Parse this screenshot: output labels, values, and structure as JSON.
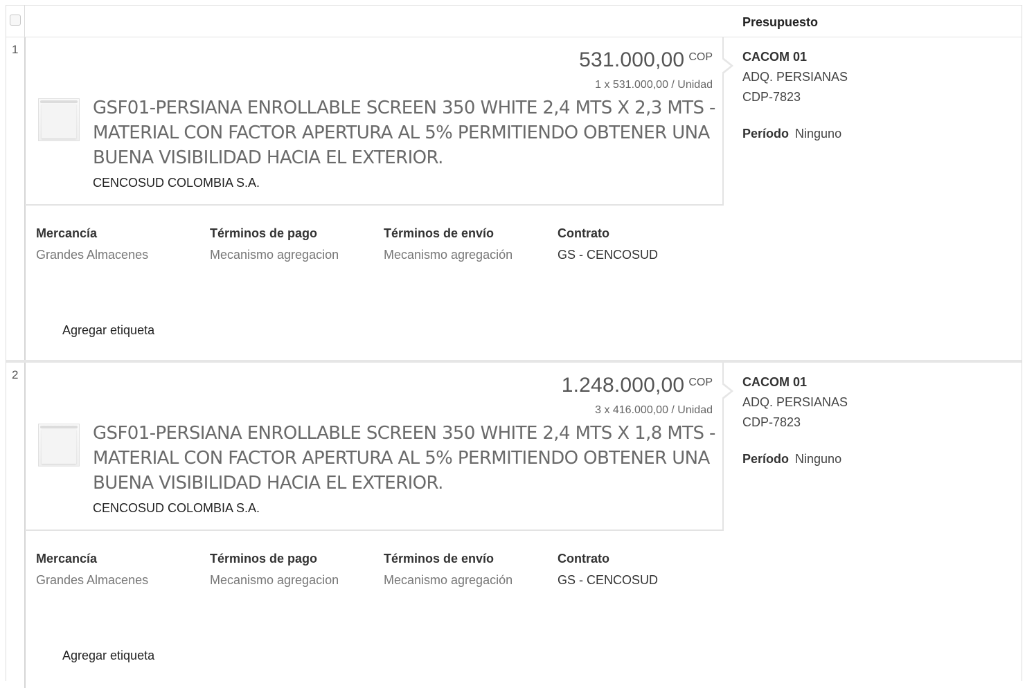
{
  "header": {
    "budget_title": "Presupuesto"
  },
  "items": [
    {
      "row_number": "1",
      "price_amount": "531.000,00",
      "currency": "COP",
      "unit_price": "1 x 531.000,00 / Unidad",
      "description": "GSF01-PERSIANA ENROLLABLE SCREEN 350 WHITE 2,4 MTS X 2,3 MTS - MATERIAL CON FACTOR APERTURA AL 5% PERMITIENDO OBTENER UNA BUENA VISIBILIDAD HACIA EL EXTERIOR.",
      "supplier": "CENCOSUD COLOMBIA S.A.",
      "details": [
        {
          "title": "Mercancía",
          "value": "Grandes Almacenes"
        },
        {
          "title": "Términos de pago",
          "value": "Mecanismo agregacion"
        },
        {
          "title": "Términos de envío",
          "value": "Mecanismo agregación"
        },
        {
          "title": "Contrato",
          "value": "GS - CENCOSUD"
        }
      ],
      "add_tag": "Agregar etiqueta",
      "budget": {
        "code": "CACOM 01",
        "line1": "ADQ. PERSIANAS",
        "line2": "CDP-7823",
        "period_label": "Período",
        "period_value": "Ninguno"
      }
    },
    {
      "row_number": "2",
      "price_amount": "1.248.000,00",
      "currency": "COP",
      "unit_price": "3 x 416.000,00 / Unidad",
      "description": "GSF01-PERSIANA ENROLLABLE SCREEN 350 WHITE 2,4 MTS X 1,8 MTS - MATERIAL CON FACTOR APERTURA AL 5% PERMITIENDO OBTENER UNA BUENA VISIBILIDAD HACIA EL EXTERIOR.",
      "supplier": "CENCOSUD COLOMBIA S.A.",
      "details": [
        {
          "title": "Mercancía",
          "value": "Grandes Almacenes"
        },
        {
          "title": "Términos de pago",
          "value": "Mecanismo agregacion"
        },
        {
          "title": "Términos de envío",
          "value": "Mecanismo agregación"
        },
        {
          "title": "Contrato",
          "value": "GS - CENCOSUD"
        }
      ],
      "add_tag": "Agregar etiqueta",
      "budget": {
        "code": "CACOM 01",
        "line1": "ADQ. PERSIANAS",
        "line2": "CDP-7823",
        "period_label": "Período",
        "period_value": "Ninguno"
      }
    }
  ]
}
